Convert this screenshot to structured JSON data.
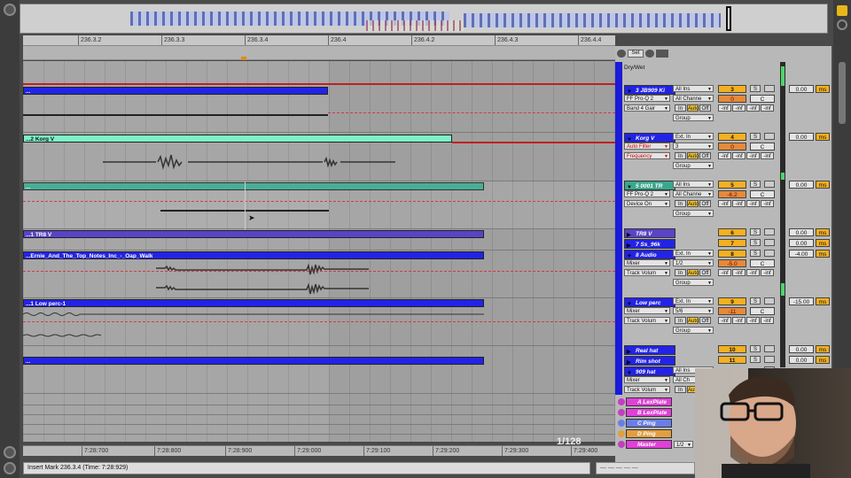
{
  "overview": {
    "label": "Arrangement overview"
  },
  "ruler": {
    "beats": [
      "236.3.2",
      "236.3.3",
      "236.3.4",
      "236.4",
      "236.4.2",
      "236.4.3",
      "236.4.4"
    ]
  },
  "time_ruler": {
    "times": [
      "7:28:700",
      "7:28:800",
      "7:28:900",
      "7:29:000",
      "7:29:100",
      "7:29:200",
      "7:29:300",
      "7:29:400"
    ]
  },
  "zoom": "1/128",
  "status": {
    "message": "Insert Mark 236.3.4 (Time: 7:28:929)"
  },
  "mixer_top": {
    "set_label": "Set",
    "drywet_label": "Dry/Wet"
  },
  "clips": [
    {
      "name": "...",
      "color": "#2323e6"
    },
    {
      "name": "...2 Korg V",
      "color": "#7ef2c6"
    },
    {
      "name": "...",
      "color": "#3aa88e"
    },
    {
      "name": "...1 TR8 V",
      "color": "#5a43c7"
    },
    {
      "name": "...Ernie_And_The_Top_Notes_Inc_-_Oap_Walk",
      "color": "#2323e6"
    },
    {
      "name": "...1 Low perc-1",
      "color": "#2323e6"
    },
    {
      "name": "...",
      "color": "#2323e6"
    }
  ],
  "tracks": [
    {
      "name": "3 JB909 Ki",
      "color": "#2323e6",
      "input": "All Ins",
      "device": "FF Pro-Q 2",
      "channel": "All Channe",
      "param": "Band 4 Gair",
      "number": "3",
      "send_a": "0",
      "pan": "C",
      "vol": "0.00",
      "ms": "ms",
      "monitor": [
        "In",
        "Auto",
        "Off"
      ],
      "sends": [
        "-inf",
        "-inf",
        "-inf",
        "-inf"
      ],
      "group": "Group",
      "solo": "S"
    },
    {
      "name": "Korg V",
      "color": "#2323e6",
      "input": "Ext. In",
      "device": "Auto Filter",
      "channel": "3",
      "param": "Frequency",
      "number": "4",
      "send_a": "0",
      "pan": "C",
      "vol": "0.00",
      "ms": "ms",
      "monitor": [
        "In",
        "Auto",
        "Off"
      ],
      "sends": [
        "-inf",
        "-inf",
        "-inf",
        "-inf"
      ],
      "group": "Group",
      "solo": "S"
    },
    {
      "name": "5 0001 TR",
      "color": "#3aa88e",
      "input": "All Ins",
      "device": "FF Pro-Q 2",
      "channel": "All Channe",
      "param": "Device On",
      "number": "5",
      "send_a": "-6.2",
      "pan": "C",
      "vol": "0.00",
      "ms": "ms",
      "monitor": [
        "In",
        "Auto",
        "Off"
      ],
      "sends": [
        "-inf",
        "-inf",
        "-inf",
        "-inf"
      ],
      "group": "Group",
      "solo": "S"
    },
    {
      "name": "TR8 V",
      "color": "#5a43c7",
      "number": "6",
      "vol": "0.00",
      "ms": "ms",
      "solo": "S"
    },
    {
      "name": "7 Ss_96k",
      "color": "#2323e6",
      "number": "7",
      "vol": "0.00",
      "ms": "ms",
      "solo": "S"
    },
    {
      "name": "8 Audio",
      "color": "#2323e6",
      "input": "Ext. In",
      "device": "Mixer",
      "channel": "1/2",
      "param": "Track Volum",
      "number": "8",
      "send_a": "-5.0",
      "pan": "C",
      "vol": "-4.00",
      "ms": "ms",
      "monitor": [
        "In",
        "Auto",
        "Off"
      ],
      "sends": [
        "-inf",
        "-inf",
        "-inf",
        "-inf"
      ],
      "group": "Group",
      "solo": "S"
    },
    {
      "name": "Low perc",
      "color": "#2323e6",
      "input": "Ext. In",
      "device": "Mixer",
      "channel": "5/6",
      "param": "Track Volum",
      "number": "9",
      "send_a": "-11",
      "pan_val": "9",
      "pan": "C",
      "vol": "-15.00",
      "ms": "ms",
      "monitor": [
        "In",
        "Auto",
        "Off"
      ],
      "sends": [
        "-inf",
        "-inf",
        "-inf",
        "-inf"
      ],
      "group": "Group",
      "solo": "S"
    },
    {
      "name": "Real hat",
      "color": "#2323e6",
      "number": "10",
      "vol": "0.00",
      "ms": "ms",
      "solo": "S"
    },
    {
      "name": "Rim shot",
      "color": "#2323e6",
      "number": "11",
      "vol": "0.00",
      "ms": "ms",
      "solo": "S"
    },
    {
      "name": "909 hat",
      "color": "#2323e6",
      "input": "All Ins",
      "device": "Mixer",
      "channel": "All Ch",
      "param": "Track Volum",
      "monitor": [
        "In",
        "Auto"
      ]
    }
  ],
  "returns": [
    {
      "name": "A LexPlate",
      "color": "#e040d8"
    },
    {
      "name": "B LexPlate",
      "color": "#e040d8"
    },
    {
      "name": "C Ping Pong",
      "color": "#6a7ee6"
    },
    {
      "name": "D Ping Pong",
      "color": "#e0a040"
    },
    {
      "name": "Master",
      "color": "#e040d8",
      "io": "1/2"
    }
  ]
}
